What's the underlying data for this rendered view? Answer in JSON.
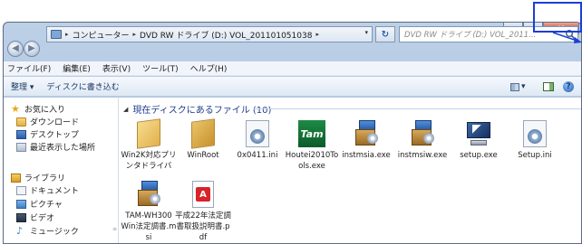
{
  "window": {
    "address": {
      "crumbs": [
        "コンピューター",
        "DVD RW ドライブ (D:) VOL_201101051038"
      ],
      "separator": "▸"
    },
    "search_placeholder": "DVD RW ドライブ (D:) VOL_2011...",
    "caption": {
      "minimize": "minimize",
      "maximize": "maximize",
      "close": "✕"
    },
    "nav": {
      "back_icon": "◀",
      "forward_icon": "▶",
      "history_icon": "▾",
      "refresh_icon": "↻",
      "dropdown_icon": "▾"
    }
  },
  "menubar": {
    "items": [
      "ファイル(F)",
      "編集(E)",
      "表示(V)",
      "ツール(T)",
      "ヘルプ(H)"
    ]
  },
  "commandbar": {
    "items": [
      "整理 ▾",
      "ディスクに書き込む"
    ],
    "view_dropdown": "▾",
    "help_icon": "?"
  },
  "navpane": {
    "favorites_header": "お気に入り",
    "favorites": [
      "ダウンロード",
      "デスクトップ",
      "最近表示した場所"
    ],
    "libraries_header": "ライブラリ",
    "libraries": [
      "ドキュメント",
      "ピクチャ",
      "ビデオ",
      "ミュージック"
    ],
    "scroll_marker": "≡"
  },
  "filepane": {
    "group_title": "現在ディスクにあるファイル (10)",
    "group_chevron": "◢",
    "files": [
      {
        "name": "Win2K対応プリンタドライバ",
        "icon": "folder-icon"
      },
      {
        "name": "WinRoot",
        "icon": "folder-icon"
      },
      {
        "name": "0x0411.ini",
        "icon": "ini-file-icon"
      },
      {
        "name": "Houtei2010Tools.exe",
        "icon": "gvm-app-icon",
        "icon_text": "Tam"
      },
      {
        "name": "instmsia.exe",
        "icon": "installer-icon"
      },
      {
        "name": "instmsiw.exe",
        "icon": "installer-icon"
      },
      {
        "name": "setup.exe",
        "icon": "setup-computer-icon"
      },
      {
        "name": "Setup.ini",
        "icon": "ini-file-icon"
      },
      {
        "name": "TAM-WH300 Win法定調書.msi",
        "icon": "installer-icon"
      },
      {
        "name": "平成22年法定調書取扱説明書.pdf",
        "icon": "pdf-icon",
        "icon_text": "A"
      }
    ]
  },
  "colors": {
    "accent_highlight": "#1a3fd6",
    "group_title": "#1e3a8a",
    "window_frame": "#bcd0e6"
  }
}
